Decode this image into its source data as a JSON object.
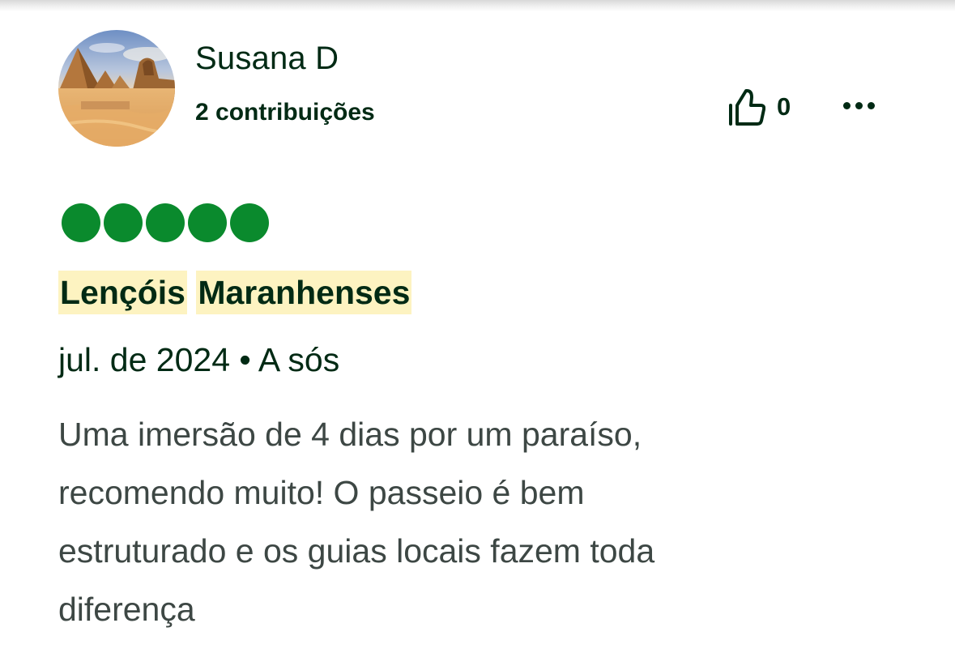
{
  "author": {
    "name": "Susana D",
    "contributions": "2 contribuições",
    "avatar_icon": "avatar-pyramids-photo"
  },
  "actions": {
    "vote_icon": "thumbs-up-icon",
    "vote_count": "0",
    "more_icon": "more-options-icon"
  },
  "rating": {
    "value": 5,
    "max": 5,
    "color": "#0a8a2d"
  },
  "review": {
    "title_part1": "Lençóis",
    "title_part2": "Maranhenses",
    "highlight_color": "#fdf3c1",
    "date": "jul. de 2024",
    "separator": "•",
    "trip_type": "A sós",
    "text_lines": [
      "Uma imersão de 4 dias por um paraíso,",
      "recomendo muito! O passeio é bem",
      "estruturado e os guias locais fazem toda",
      "diferença"
    ]
  }
}
